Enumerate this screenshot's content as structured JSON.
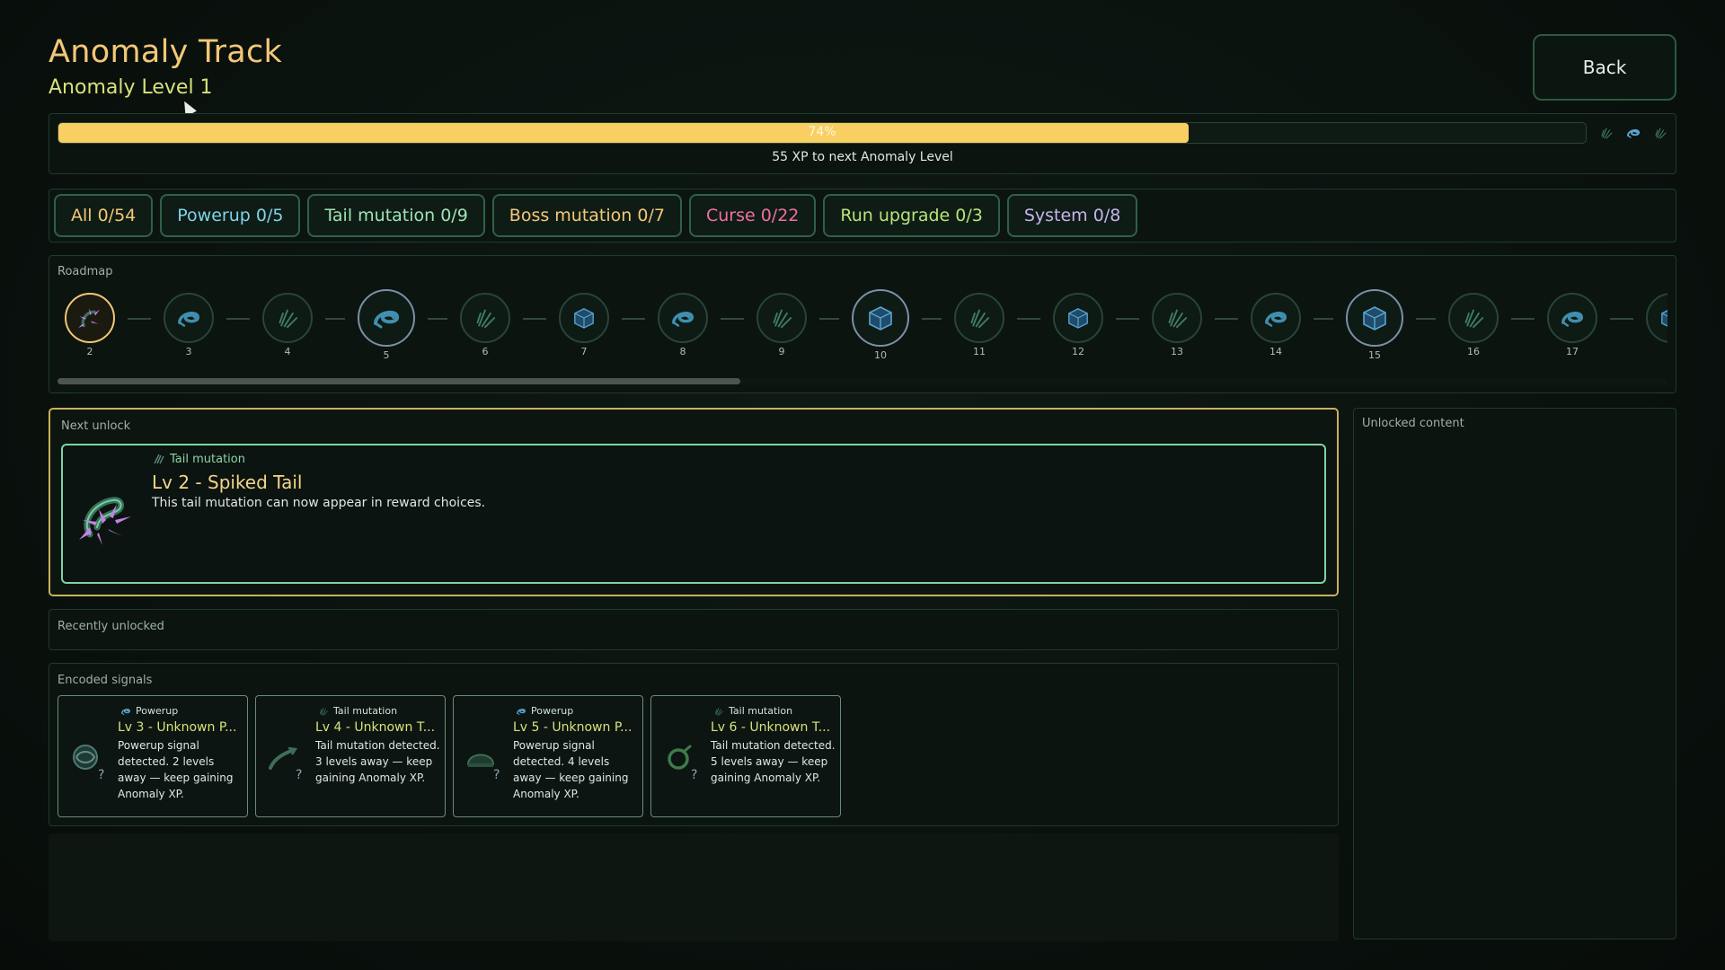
{
  "header": {
    "title": "Anomaly Track",
    "subtitle": "Anomaly Level 1",
    "back_label": "Back"
  },
  "progress": {
    "percent": 74,
    "percent_label": "74%",
    "next_label": "55 XP to next Anomaly Level",
    "icons": [
      "claw-icon",
      "tail-icon",
      "claw-icon"
    ]
  },
  "filters": [
    {
      "label": "All 0/54",
      "color": "#f3c777"
    },
    {
      "label": "Powerup 0/5",
      "color": "#7fd3ea"
    },
    {
      "label": "Tail mutation 0/9",
      "color": "#9ee3b4"
    },
    {
      "label": "Boss mutation 0/7",
      "color": "#f3c777"
    },
    {
      "label": "Curse 0/22",
      "color": "#ef6fa5"
    },
    {
      "label": "Run upgrade 0/3",
      "color": "#b8e37a"
    },
    {
      "label": "System 0/8",
      "color": "#c5b4ef"
    }
  ],
  "roadmap": {
    "label": "Roadmap",
    "nodes": [
      {
        "level": "2",
        "icon": "spiked-tail-icon",
        "current": true
      },
      {
        "level": "3",
        "icon": "tail-icon"
      },
      {
        "level": "4",
        "icon": "claw-icon"
      },
      {
        "level": "5",
        "icon": "tail-icon",
        "big": true
      },
      {
        "level": "6",
        "icon": "claw-icon"
      },
      {
        "level": "7",
        "icon": "cube-icon"
      },
      {
        "level": "8",
        "icon": "tail-icon"
      },
      {
        "level": "9",
        "icon": "claw-icon"
      },
      {
        "level": "10",
        "icon": "cube-icon",
        "big": true
      },
      {
        "level": "11",
        "icon": "claw-icon"
      },
      {
        "level": "12",
        "icon": "cube-icon"
      },
      {
        "level": "13",
        "icon": "claw-icon"
      },
      {
        "level": "14",
        "icon": "tail-icon"
      },
      {
        "level": "15",
        "icon": "cube-icon",
        "big": true
      },
      {
        "level": "16",
        "icon": "claw-icon"
      },
      {
        "level": "17",
        "icon": "tail-icon"
      },
      {
        "level": "",
        "icon": "cube-icon"
      }
    ]
  },
  "next_unlock": {
    "label": "Next unlock",
    "type": "Tail mutation",
    "title": "Lv 2 - Spiked Tail",
    "description": "This tail mutation can now appear in reward choices.",
    "icon": "spiked-tail-icon"
  },
  "recently_unlocked": {
    "label": "Recently unlocked"
  },
  "encoded_signals": {
    "label": "Encoded signals",
    "items": [
      {
        "type": "Powerup",
        "title": "Lv 3 - Unknown P...",
        "description": "Powerup signal detected. 2 levels away — keep gaining Anomaly XP.",
        "icon": "orb-icon"
      },
      {
        "type": "Tail mutation",
        "title": "Lv 4 - Unknown T...",
        "description": "Tail mutation detected. 3 levels away — keep gaining Anomaly XP.",
        "icon": "tail-sweep-icon"
      },
      {
        "type": "Powerup",
        "title": "Lv 5 - Unknown P...",
        "description": "Powerup signal detected. 4 levels away — keep gaining Anomaly XP.",
        "icon": "helmet-icon"
      },
      {
        "type": "Tail mutation",
        "title": "Lv 6 - Unknown T...",
        "description": "Tail mutation detected. 5 levels away — keep gaining Anomaly XP.",
        "icon": "tail-coil-icon"
      }
    ],
    "unknown_mark": "?"
  },
  "unlocked_content": {
    "label": "Unlocked content"
  }
}
